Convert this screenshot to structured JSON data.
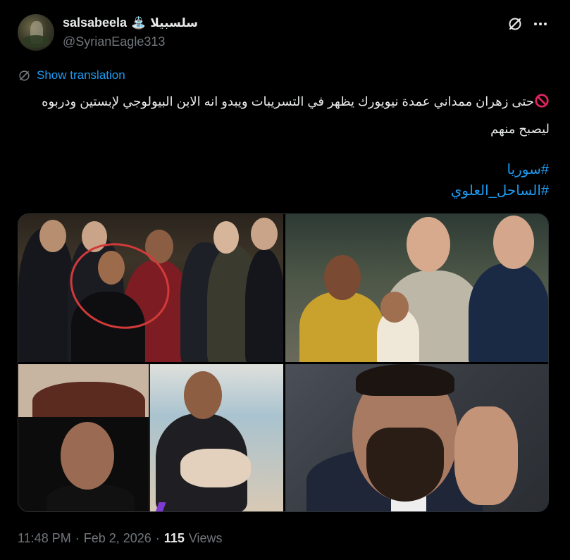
{
  "author": {
    "display_name": "salsabeela",
    "emoji": "⛲",
    "arabic_name": "سلسبيلا",
    "handle": "@SyrianEagle313"
  },
  "header_icons": [
    "grok-icon",
    "more-options-icon"
  ],
  "translation": {
    "label": "Show translation",
    "icon": "translate-icon"
  },
  "tweet": {
    "prohibit_emoji": "🚫",
    "line1": "حتى زهران ممداني عمدة نيويورك يظهر في التسريبات  ويبدو انه الابن البيولوجي لإبستين ودربوه",
    "line2": "ليصبح منهم",
    "hashtags": [
      "#سوريا",
      "#الساحل_العلوي"
    ]
  },
  "media": {
    "count": 4,
    "images": [
      "group-photo-with-circled-boy",
      "woman-holding-baby-with-two-men",
      "collage-baby-and-man-smiling",
      "bearded-man-portrait"
    ]
  },
  "meta": {
    "time": "11:48 PM",
    "date": "Feb 2, 2026",
    "views_count": "115",
    "views_label": "Views"
  },
  "colors": {
    "background": "#000000",
    "text": "#e7e9ea",
    "muted": "#71767b",
    "accent": "#1d9bf0",
    "border": "#2f3336"
  }
}
